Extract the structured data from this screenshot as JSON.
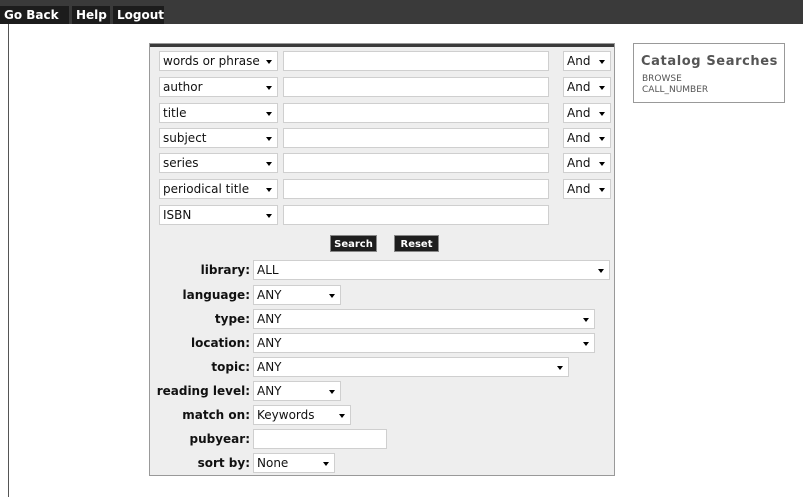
{
  "topbar": {
    "go_back": "Go Back",
    "help": "Help",
    "logout": "Logout"
  },
  "search_rows": [
    {
      "field": "words or phrase",
      "term": "",
      "bool": "And"
    },
    {
      "field": "author",
      "term": "",
      "bool": "And"
    },
    {
      "field": "title",
      "term": "",
      "bool": "And"
    },
    {
      "field": "subject",
      "term": "",
      "bool": "And"
    },
    {
      "field": "series",
      "term": "",
      "bool": "And"
    },
    {
      "field": "periodical title",
      "term": "",
      "bool": "And"
    },
    {
      "field": "ISBN",
      "term": ""
    }
  ],
  "buttons": {
    "search": "Search",
    "reset": "Reset"
  },
  "filters": {
    "library": {
      "label": "library:",
      "value": "ALL"
    },
    "language": {
      "label": "language:",
      "value": "ANY"
    },
    "type": {
      "label": "type:",
      "value": "ANY"
    },
    "location": {
      "label": "location:",
      "value": "ANY"
    },
    "topic": {
      "label": "topic:",
      "value": "ANY"
    },
    "reading_level": {
      "label": "reading level:",
      "value": "ANY"
    },
    "match_on": {
      "label": "match on:",
      "value": "Keywords"
    },
    "pubyear": {
      "label": "pubyear:",
      "value": ""
    },
    "sort_by": {
      "label": "sort by:",
      "value": "None"
    }
  },
  "catalog": {
    "title": "Catalog Searches",
    "links": [
      "BROWSE",
      "CALL_NUMBER"
    ]
  },
  "colors": {
    "topbar": "#3a3a3a",
    "button": "#1e1e1e",
    "form_bg": "#eeeeee"
  }
}
